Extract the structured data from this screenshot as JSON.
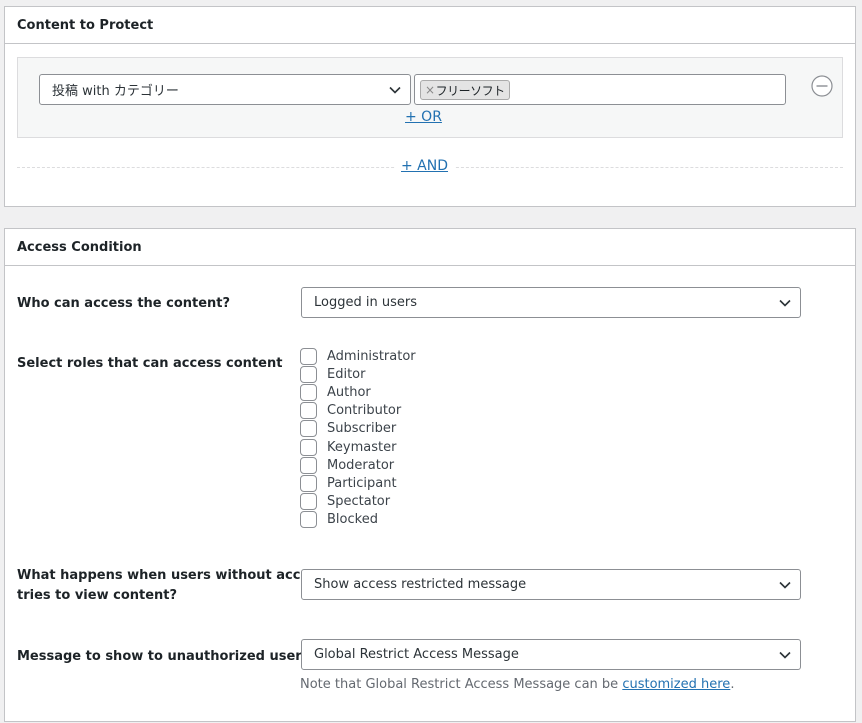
{
  "content_protect": {
    "title": "Content to Protect",
    "rule_type_select": "投稿 with カテゴリー",
    "tags": [
      "フリーソフト"
    ],
    "or_link": "+ OR",
    "and_link": "+ AND"
  },
  "access_condition": {
    "title": "Access Condition",
    "who_label": "Who can access the content?",
    "who_value": "Logged in users",
    "roles_label": "Select roles that can access content",
    "roles": [
      {
        "label": "Administrator",
        "checked": false
      },
      {
        "label": "Editor",
        "checked": false
      },
      {
        "label": "Author",
        "checked": false
      },
      {
        "label": "Contributor",
        "checked": false
      },
      {
        "label": "Subscriber",
        "checked": false
      },
      {
        "label": "Keymaster",
        "checked": false
      },
      {
        "label": "Moderator",
        "checked": false
      },
      {
        "label": "Participant",
        "checked": false
      },
      {
        "label": "Spectator",
        "checked": false
      },
      {
        "label": "Blocked",
        "checked": false
      }
    ],
    "action_label_line1": "What happens when users without access",
    "action_label_line2": "tries to view content?",
    "action_value": "Show access restricted message",
    "message_label": "Message to show to unauthorized users",
    "message_value": "Global Restrict Access Message",
    "note_prefix": "Note that Global Restrict Access Message can be ",
    "note_link": "customized here",
    "note_suffix": "."
  }
}
